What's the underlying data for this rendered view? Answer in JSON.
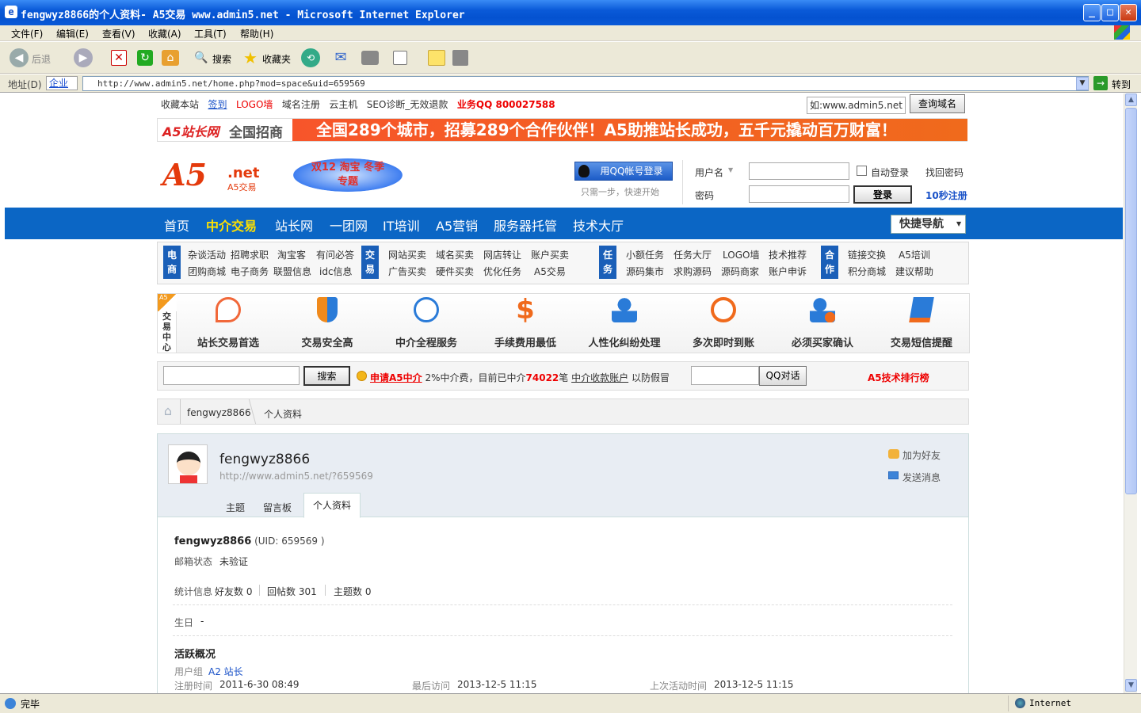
{
  "window": {
    "title": "fengwyz8866的个人资料- A5交易 www.admin5.net - Microsoft Internet Explorer",
    "min": "_",
    "max": "□",
    "close": "✕"
  },
  "menu": [
    "文件(F)",
    "编辑(E)",
    "查看(V)",
    "收藏(A)",
    "工具(T)",
    "帮助(H)"
  ],
  "toolbar": {
    "back": "后退",
    "search": "搜索",
    "favorites": "收藏夹"
  },
  "address": {
    "label": "地址(D)",
    "enterprise": "企业",
    "url": "http://www.admin5.net/home.php?mod=space&uid=659569",
    "go": "转到"
  },
  "status": {
    "left": "完毕",
    "zone": "Internet"
  },
  "topbar": {
    "items": [
      "收藏本站",
      "签到",
      "LOGO墙",
      "域名注册",
      "云主机",
      "SEO诊断_无效退款"
    ],
    "qq": "业务QQ 800027588",
    "domain_placeholder": "如:www.admin5.net",
    "domain_button": "查询域名"
  },
  "banner": {
    "logo_text": "A5站长网",
    "recruit": "全国招商",
    "slogan": "全国289个城市，招募289个合作伙伴！A5助推站长成功，五千元撬动百万财富！"
  },
  "header": {
    "logo_net": ".net",
    "logo_sub": "A5交易",
    "promo": "双12 淘宝 冬季专题",
    "qq_login": "用QQ帐号登录",
    "qq_hint": "只需一步，快速开始",
    "username_label": "用户名",
    "password_label": "密码",
    "auto_login": "自动登录",
    "forgot": "找回密码",
    "login_button": "登录",
    "register": "10秒注册"
  },
  "nav": {
    "items": [
      "首页",
      "中介交易",
      "站长网",
      "一团网",
      "IT培训",
      "A5营销",
      "服务器托管",
      "技术大厅"
    ],
    "active": "中介交易",
    "quick": "快捷导航"
  },
  "categories": {
    "ecommerce": {
      "tag": "电商",
      "row1": [
        "杂谈活动",
        "招聘求职",
        "淘宝客",
        "有问必答"
      ],
      "row2": [
        "团购商城",
        "电子商务",
        "联盟信息",
        "idc信息"
      ]
    },
    "trade": {
      "tag": "交易",
      "row1": [
        "网站买卖",
        "域名买卖",
        "网店转让",
        "账户买卖"
      ],
      "row2": [
        "广告买卖",
        "硬件买卖",
        "优化任务",
        "A5交易"
      ]
    },
    "task": {
      "tag": "任务",
      "row1": [
        "小额任务",
        "任务大厅",
        "LOGO墙",
        "技术推荐"
      ],
      "row2": [
        "源码集市",
        "求购源码",
        "源码商家",
        "账户申诉"
      ]
    },
    "coop": {
      "tag": "合作",
      "row1": [
        "链接交换",
        "A5培训"
      ],
      "row2": [
        "积分商城",
        "建议帮助"
      ]
    }
  },
  "features": {
    "side_label": "交易中心",
    "side_tag": "A5",
    "items": [
      "站长交易首选",
      "交易安全高",
      "中介全程服务",
      "手续费用最低",
      "人性化纠纷处理",
      "多次即时到账",
      "必须买家确认",
      "交易短信提醒"
    ]
  },
  "searchbar": {
    "search_button": "搜索",
    "apply": "申请A5中介",
    "fee": "2%中介费，目前已中介",
    "count": "74022",
    "unit": "笔",
    "account": "中介收款账户",
    "anti_fake": "以防假冒",
    "qq_button": "QQ对话",
    "rank": "A5技术排行榜"
  },
  "breadcrumb": {
    "home_icon": "home-icon",
    "user": "fengwyz8866",
    "page": "个人资料"
  },
  "profile": {
    "username": "fengwyz8866",
    "space_url": "http://www.admin5.net/?659569",
    "add_friend": "加为好友",
    "send_message": "发送消息",
    "tabs": [
      "主题",
      "留言板",
      "个人资料"
    ],
    "active_tab": "个人资料",
    "uid_line": "(UID: 659569 )",
    "email_label": "邮箱状态",
    "email_value": "未验证",
    "stats_label": "统计信息",
    "friends": "好友数 0",
    "replies": "回帖数 301",
    "threads": "主题数 0",
    "birthday_label": "生日",
    "birthday_value": "-",
    "activity_title": "活跃概况",
    "group_label": "用户组",
    "group_value": "A2 站长",
    "reg_label": "注册时间",
    "reg_value": "2011-6-30 08:49",
    "last_visit_label": "最后访问",
    "last_visit_value": "2013-12-5 11:15",
    "last_active_label": "上次活动时间",
    "last_active_value": "2013-12-5 11:15"
  },
  "colors": {
    "nav_blue": "#0b66c5",
    "accent_red": "#e00000",
    "banner_orange": "#f05a1e",
    "link_blue": "#1a52c8"
  }
}
